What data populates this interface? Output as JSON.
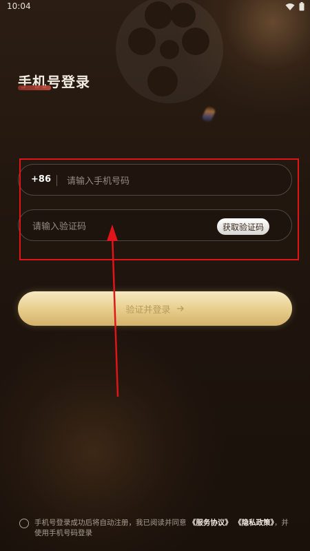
{
  "status_bar": {
    "time": "10:04"
  },
  "title": "手机号登录",
  "phone": {
    "country_code": "+86",
    "placeholder": "请输入手机号码",
    "value": ""
  },
  "code": {
    "placeholder": "请输入验证码",
    "value": "",
    "get_code_label": "获取验证码"
  },
  "login_button": {
    "label": "验证并登录"
  },
  "agreement": {
    "prefix": "手机号登录成功后将自动注册，我已阅读并同意",
    "service_link": "《服务协议》",
    "privacy_link": "《隐私政策》",
    "suffix": "，并使用手机号码登录"
  },
  "colors": {
    "highlight": "#e0151a",
    "accent": "#e8cf8e",
    "title_underline": "#c24a3c"
  }
}
